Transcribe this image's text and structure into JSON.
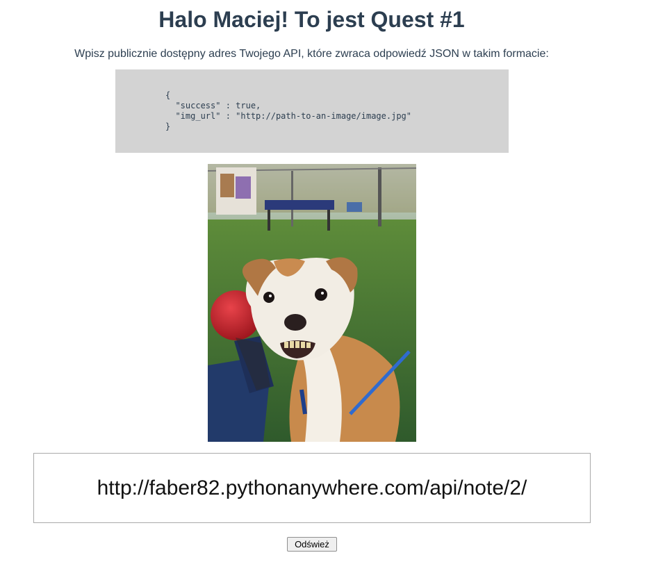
{
  "header": {
    "title": "Halo Maciej! To jest Quest #1"
  },
  "instructions": {
    "text": "Wpisz publicznie dostępny adres Twojego API, które zwraca odpowiedź JSON w takim formacie:"
  },
  "code_example": {
    "text": "{\n  \"success\" : true,\n  \"img_url\" : \"http://path-to-an-image/image.jpg\"\n}"
  },
  "image": {
    "icon": "dog-photo",
    "alt": "dog"
  },
  "url_input": {
    "value": "http://faber82.pythonanywhere.com/api/note/2/"
  },
  "refresh_button": {
    "label": "Odśwież"
  },
  "colors": {
    "heading": "#2c3e50",
    "code_background": "#d3d3d3",
    "input_border": "#a9a9a9"
  }
}
